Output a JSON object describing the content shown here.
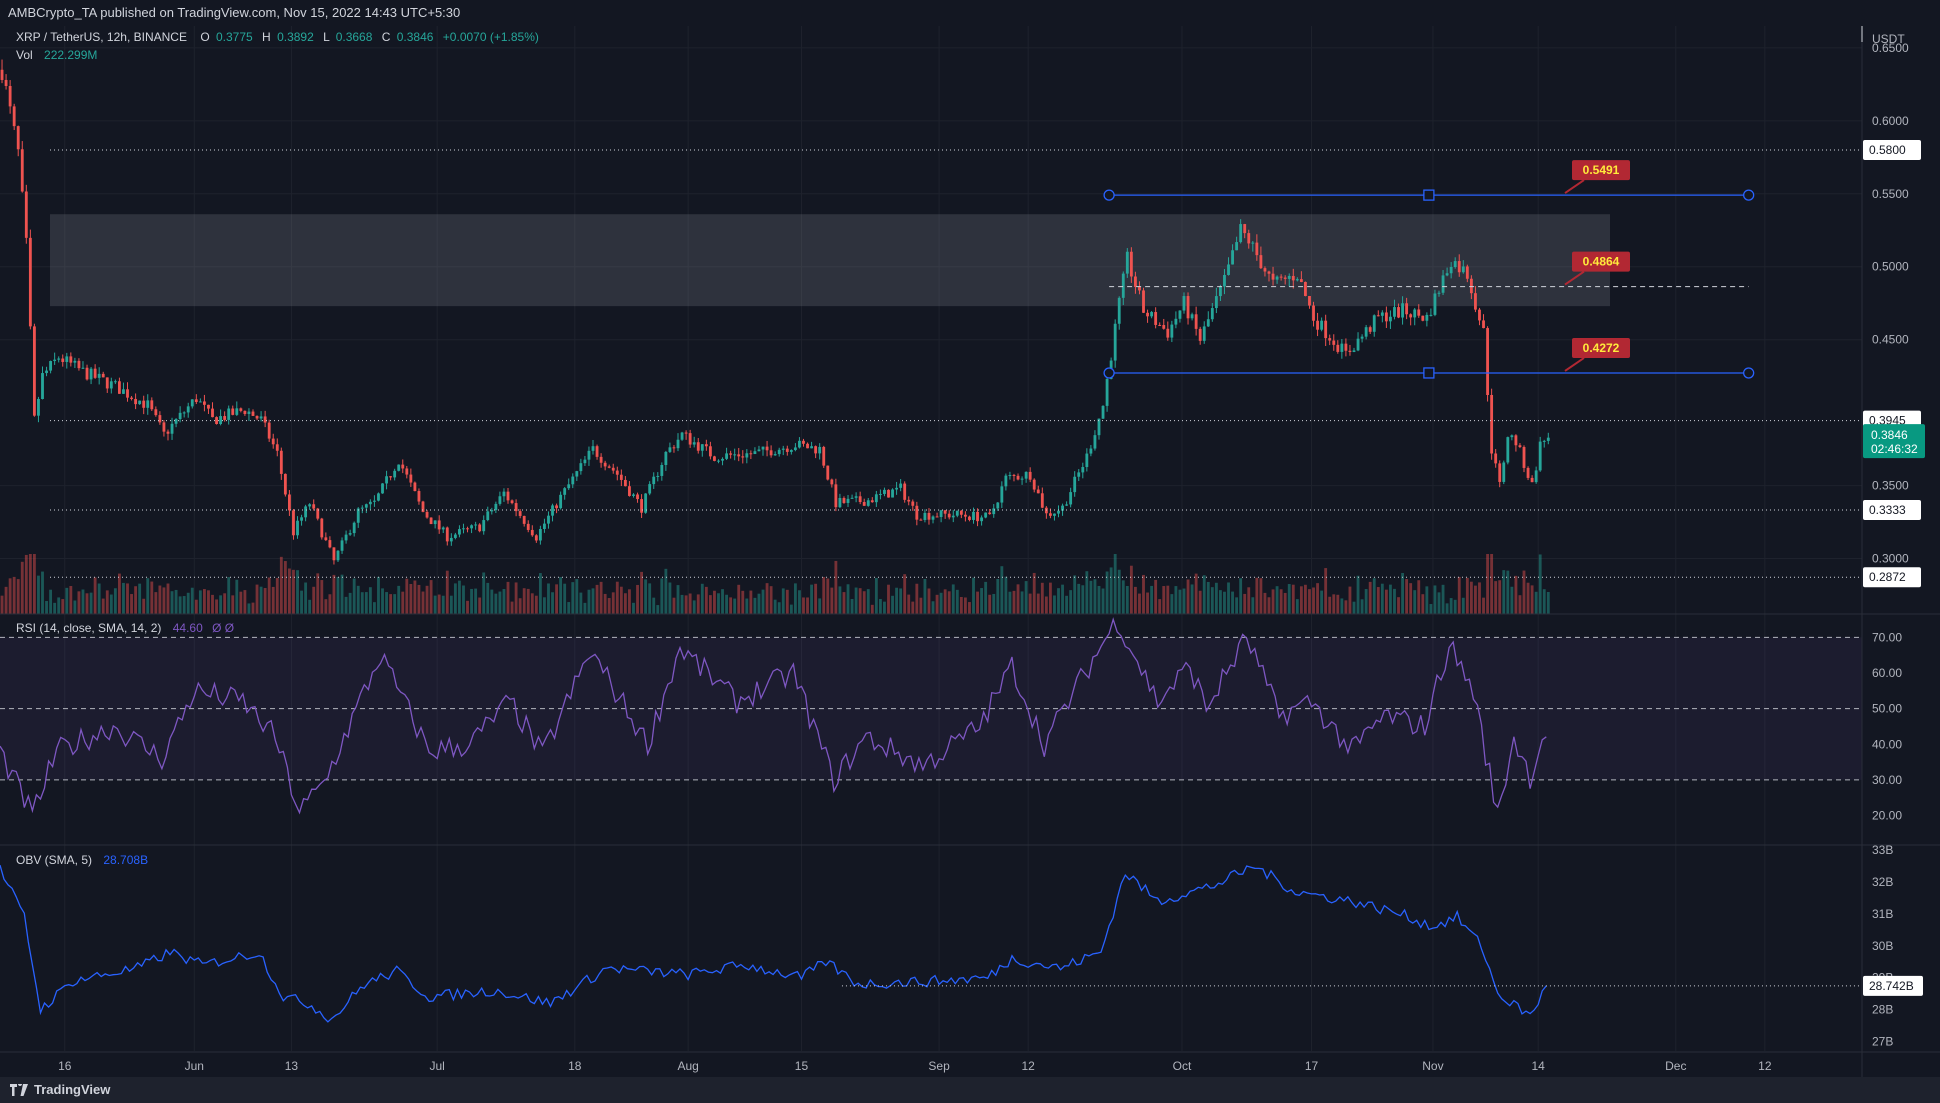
{
  "header": {
    "published": "AMBCrypto_TA published on TradingView.com, Nov 15, 2022 14:43 UTC+5:30"
  },
  "footer": {
    "brand": "TradingView",
    "logo_icon": "tradingview-logo-icon"
  },
  "legend": {
    "pair": "XRP / TetherUS, 12h, BINANCE",
    "o_label": "O",
    "o": "0.3775",
    "h_label": "H",
    "h": "0.3892",
    "l_label": "L",
    "l": "0.3668",
    "c_label": "C",
    "c": "0.3846",
    "change": "+0.0070 (+1.85%)",
    "vol_label": "Vol",
    "vol": "222.299M",
    "rsi_label": "RSI (14, close, SMA, 14, 2)",
    "rsi_value": "44.60",
    "rsi_na": "Ø Ø",
    "obv_label": "OBV (SMA, 5)",
    "obv_value": "28.708B"
  },
  "colors": {
    "background": "#131722",
    "up": "#26a69a",
    "down": "#ef5350",
    "rsi_line": "#7e57c2",
    "obv_line": "#2962ff",
    "range_line": "#2962ff",
    "callout": "#b22833",
    "callout_text": "#ffeb3b",
    "price_badge": "#089981"
  },
  "chart_data": [
    {
      "type": "candlestick",
      "title": "",
      "timeframe": "12h",
      "currency": "USDT",
      "ylim": [
        0.262,
        0.665
      ],
      "y_ticks": [
        "0.6500",
        "0.6000",
        "0.5500",
        "0.5000",
        "0.4500",
        "0.3500",
        "0.3000"
      ],
      "x_ticks": [
        "16",
        "Jun",
        "13",
        "Jul",
        "18",
        "Aug",
        "15",
        "Sep",
        "12",
        "Oct",
        "17",
        "Nov",
        "14",
        "Dec",
        "12"
      ],
      "x_tick_dates": [
        "2022-05-16",
        "2022-06-01",
        "2022-06-13",
        "2022-07-01",
        "2022-07-18",
        "2022-08-01",
        "2022-08-15",
        "2022-09-01",
        "2022-09-12",
        "2022-10-01",
        "2022-10-17",
        "2022-11-01",
        "2022-11-14",
        "2022-12-01",
        "2022-12-12"
      ],
      "x_range": [
        "2022-05-08",
        "2022-12-24"
      ],
      "close_path": [
        [
          "2022-05-08",
          0.635
        ],
        [
          "2022-05-10",
          0.578
        ],
        [
          "2022-05-11",
          0.515
        ],
        [
          "2022-05-12",
          0.395
        ],
        [
          "2022-05-13",
          0.425
        ],
        [
          "2022-05-15",
          0.438
        ],
        [
          "2022-05-18",
          0.428
        ],
        [
          "2022-05-22",
          0.418
        ],
        [
          "2022-05-26",
          0.405
        ],
        [
          "2022-05-28",
          0.385
        ],
        [
          "2022-06-01",
          0.41
        ],
        [
          "2022-06-03",
          0.395
        ],
        [
          "2022-06-07",
          0.402
        ],
        [
          "2022-06-09",
          0.395
        ],
        [
          "2022-06-11",
          0.372
        ],
        [
          "2022-06-13",
          0.318
        ],
        [
          "2022-06-15",
          0.338
        ],
        [
          "2022-06-18",
          0.298
        ],
        [
          "2022-06-21",
          0.332
        ],
        [
          "2022-06-23",
          0.338
        ],
        [
          "2022-06-26",
          0.368
        ],
        [
          "2022-06-29",
          0.332
        ],
        [
          "2022-07-02",
          0.315
        ],
        [
          "2022-07-06",
          0.322
        ],
        [
          "2022-07-09",
          0.345
        ],
        [
          "2022-07-13",
          0.315
        ],
        [
          "2022-07-16",
          0.342
        ],
        [
          "2022-07-20",
          0.375
        ],
        [
          "2022-07-23",
          0.358
        ],
        [
          "2022-07-26",
          0.335
        ],
        [
          "2022-07-29",
          0.372
        ],
        [
          "2022-07-31",
          0.385
        ],
        [
          "2022-08-04",
          0.37
        ],
        [
          "2022-08-09",
          0.372
        ],
        [
          "2022-08-14",
          0.378
        ],
        [
          "2022-08-17",
          0.375
        ],
        [
          "2022-08-19",
          0.338
        ],
        [
          "2022-08-23",
          0.34
        ],
        [
          "2022-08-27",
          0.348
        ],
        [
          "2022-08-29",
          0.33
        ],
        [
          "2022-09-03",
          0.33
        ],
        [
          "2022-09-07",
          0.328
        ],
        [
          "2022-09-09",
          0.355
        ],
        [
          "2022-09-12",
          0.358
        ],
        [
          "2022-09-14",
          0.33
        ],
        [
          "2022-09-16",
          0.335
        ],
        [
          "2022-09-19",
          0.37
        ],
        [
          "2022-09-21",
          0.405
        ],
        [
          "2022-09-23",
          0.475
        ],
        [
          "2022-09-24",
          0.505
        ],
        [
          "2022-09-26",
          0.47
        ],
        [
          "2022-09-29",
          0.455
        ],
        [
          "2022-10-01",
          0.475
        ],
        [
          "2022-10-03",
          0.45
        ],
        [
          "2022-10-06",
          0.49
        ],
        [
          "2022-10-08",
          0.525
        ],
        [
          "2022-10-09",
          0.518
        ],
        [
          "2022-10-12",
          0.488
        ],
        [
          "2022-10-15",
          0.495
        ],
        [
          "2022-10-17",
          0.465
        ],
        [
          "2022-10-21",
          0.44
        ],
        [
          "2022-10-25",
          0.465
        ],
        [
          "2022-10-28",
          0.47
        ],
        [
          "2022-10-31",
          0.465
        ],
        [
          "2022-11-03",
          0.505
        ],
        [
          "2022-11-05",
          0.495
        ],
        [
          "2022-11-07",
          0.455
        ],
        [
          "2022-11-08",
          0.375
        ],
        [
          "2022-11-09",
          0.35
        ],
        [
          "2022-11-10",
          0.385
        ],
        [
          "2022-11-11",
          0.38
        ],
        [
          "2022-11-13",
          0.35
        ],
        [
          "2022-11-14",
          0.3776
        ],
        [
          "2022-11-15",
          0.3846
        ]
      ],
      "current_price": "0.3846",
      "countdown": "02:46:32",
      "axis_labels": [
        "0.5800",
        "0.3945",
        "0.3333",
        "0.2872"
      ],
      "dotted_levels": [
        0.58,
        0.3945,
        0.3333,
        0.2872
      ],
      "resistance_zone": [
        0.473,
        0.536
      ],
      "range_high": 0.5491,
      "range_mid": 0.4864,
      "range_low": 0.4272,
      "range_dates": [
        "2022-09-22",
        "2022-12-10"
      ],
      "callouts": [
        "0.5491",
        "0.4864",
        "0.4272"
      ]
    },
    {
      "type": "line",
      "title": "",
      "name": "RSI (14, close, SMA, 14, 2)",
      "ylim": [
        12,
        76
      ],
      "y_ticks": [
        "70.00",
        "60.00",
        "50.00",
        "40.00",
        "30.00",
        "20.00"
      ],
      "bands": [
        70,
        50,
        30
      ],
      "path": [
        [
          "2022-05-08",
          38
        ],
        [
          "2022-05-12",
          20
        ],
        [
          "2022-05-15",
          38
        ],
        [
          "2022-05-22",
          45
        ],
        [
          "2022-05-28",
          36
        ],
        [
          "2022-06-01",
          55
        ],
        [
          "2022-06-07",
          52
        ],
        [
          "2022-06-11",
          42
        ],
        [
          "2022-06-14",
          21
        ],
        [
          "2022-06-17",
          29
        ],
        [
          "2022-06-24",
          65
        ],
        [
          "2022-06-30",
          38
        ],
        [
          "2022-07-05",
          40
        ],
        [
          "2022-07-10",
          52
        ],
        [
          "2022-07-14",
          37
        ],
        [
          "2022-07-20",
          66
        ],
        [
          "2022-07-27",
          40
        ],
        [
          "2022-07-31",
          67
        ],
        [
          "2022-08-07",
          52
        ],
        [
          "2022-08-14",
          60
        ],
        [
          "2022-08-19",
          30
        ],
        [
          "2022-08-23",
          42
        ],
        [
          "2022-08-30",
          34
        ],
        [
          "2022-09-06",
          45
        ],
        [
          "2022-09-10",
          62
        ],
        [
          "2022-09-14",
          40
        ],
        [
          "2022-09-19",
          60
        ],
        [
          "2022-09-23",
          75
        ],
        [
          "2022-09-28",
          52
        ],
        [
          "2022-10-02",
          62
        ],
        [
          "2022-10-04",
          50
        ],
        [
          "2022-10-09",
          70
        ],
        [
          "2022-10-13",
          48
        ],
        [
          "2022-10-17",
          52
        ],
        [
          "2022-10-22",
          38
        ],
        [
          "2022-10-26",
          48
        ],
        [
          "2022-10-31",
          45
        ],
        [
          "2022-11-03",
          68
        ],
        [
          "2022-11-06",
          55
        ],
        [
          "2022-11-09",
          20
        ],
        [
          "2022-11-11",
          42
        ],
        [
          "2022-11-13",
          31
        ],
        [
          "2022-11-15",
          44.6
        ]
      ]
    },
    {
      "type": "line",
      "title": "",
      "name": "OBV (SMA, 5)",
      "unit": "B",
      "ylim": [
        26.7,
        33.1
      ],
      "y_ticks": [
        "33B",
        "32B",
        "31B",
        "30B",
        "29B",
        "28B",
        "27B"
      ],
      "level": 28.742,
      "level_dates": [
        "2022-08-20",
        "2022-12-24"
      ],
      "level_label": "28.742B",
      "path": [
        [
          "2022-05-08",
          32.4
        ],
        [
          "2022-05-11",
          30.9
        ],
        [
          "2022-05-13",
          28.0
        ],
        [
          "2022-05-17",
          28.9
        ],
        [
          "2022-05-25",
          29.3
        ],
        [
          "2022-05-29",
          29.8
        ],
        [
          "2022-06-02",
          29.4
        ],
        [
          "2022-06-09",
          29.8
        ],
        [
          "2022-06-12",
          28.4
        ],
        [
          "2022-06-15",
          28.2
        ],
        [
          "2022-06-18",
          27.7
        ],
        [
          "2022-06-22",
          28.8
        ],
        [
          "2022-06-26",
          29.2
        ],
        [
          "2022-06-30",
          28.4
        ],
        [
          "2022-07-08",
          28.6
        ],
        [
          "2022-07-15",
          28.2
        ],
        [
          "2022-07-22",
          29.3
        ],
        [
          "2022-08-01",
          29.1
        ],
        [
          "2022-08-08",
          29.4
        ],
        [
          "2022-08-15",
          29.0
        ],
        [
          "2022-08-18",
          29.5
        ],
        [
          "2022-08-22",
          28.8
        ],
        [
          "2022-09-01",
          28.9
        ],
        [
          "2022-09-07",
          29.0
        ],
        [
          "2022-09-10",
          29.6
        ],
        [
          "2022-09-16",
          29.3
        ],
        [
          "2022-09-21",
          29.8
        ],
        [
          "2022-09-24",
          32.3
        ],
        [
          "2022-09-28",
          31.4
        ],
        [
          "2022-10-05",
          31.9
        ],
        [
          "2022-10-10",
          32.5
        ],
        [
          "2022-10-15",
          31.7
        ],
        [
          "2022-10-22",
          31.4
        ],
        [
          "2022-10-28",
          31.0
        ],
        [
          "2022-11-01",
          30.6
        ],
        [
          "2022-11-04",
          30.9
        ],
        [
          "2022-11-07",
          30.0
        ],
        [
          "2022-11-09",
          28.5
        ],
        [
          "2022-11-13",
          27.8
        ],
        [
          "2022-11-15",
          28.708
        ]
      ]
    }
  ]
}
